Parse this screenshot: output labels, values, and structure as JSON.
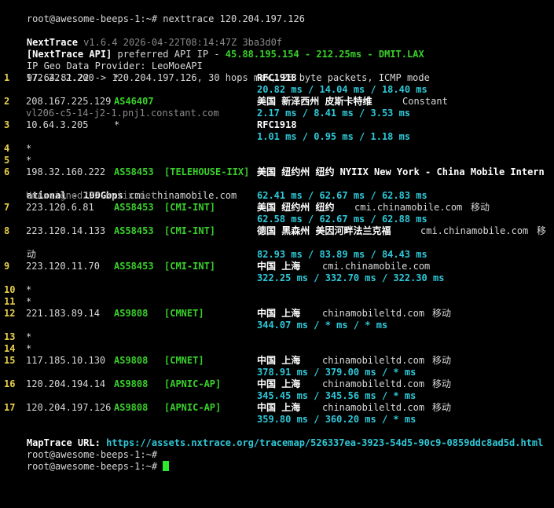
{
  "prompt": "root@awesome-beeps-1:~#",
  "command": " nexttrace 120.204.197.126",
  "header": {
    "app_name": "NextTrace",
    "version": " v1.6.4 2026-04-22T08:14:47Z 3ba3d0f",
    "api_label": "[NextTrace API]",
    "api_text": " preferred API IP - ",
    "api_ip": "45.88.195.154",
    "api_sep1": " - ",
    "api_latency": "212.25ms",
    "api_sep2": " - ",
    "api_node": "DMIT.LAX",
    "geo_provider": "IP Geo Data Provider: LeoMoeAPI",
    "route_summary": "97.64.81.22 -> 120.204.197.126, 30 hops max, 28 byte packets, ICMP mode"
  },
  "hops": [
    {
      "num": "1",
      "ip": "172.22.2.200",
      "asn": "*",
      "tag": "",
      "geo": "RFC1918",
      "domain": "",
      "note": "",
      "hostname": "",
      "rtt": "20.82 ms / 14.04 ms / 18.40 ms"
    },
    {
      "num": "2",
      "ip": "208.167.225.129",
      "asn": "AS46407",
      "tag": "",
      "geo": "美国 新泽西州 皮斯卡特维",
      "domain": "Constant",
      "note": "",
      "hostname": "vl206-c5-14-j2-1.pnj1.constant.com",
      "rtt": "2.17 ms / 8.41 ms / 3.53 ms"
    },
    {
      "num": "3",
      "ip": "10.64.3.205",
      "asn": "*",
      "tag": "",
      "geo": "RFC1918",
      "domain": "",
      "note": "",
      "hostname": "",
      "rtt": "1.01 ms / 0.95 ms / 1.18 ms"
    },
    {
      "num": "4",
      "ip": "*"
    },
    {
      "num": "5",
      "ip": "*"
    },
    {
      "num": "6",
      "ip": "198.32.160.222",
      "asn": "AS58453",
      "tag": "[TELEHOUSE-IIX]",
      "geo": "美国 纽约州 纽约 NYIIX New York - China Mobile Intern",
      "geo_wrap": "ational - 100Gbps",
      "domain": "cmi.chinamobile.com",
      "note": "",
      "hostname": "UnAssigned222.nyiix.net",
      "rtt": "62.41 ms / 62.67 ms / 62.83 ms"
    },
    {
      "num": "7",
      "ip": "223.120.6.81",
      "asn": "AS58453",
      "tag": "[CMI-INT]",
      "geo": "美国 纽约州 纽约",
      "domain": "cmi.chinamobile.com",
      "note": "移动",
      "hostname": "",
      "rtt": "62.58 ms / 62.67 ms / 62.88 ms"
    },
    {
      "num": "8",
      "ip": "223.120.14.133",
      "asn": "AS58453",
      "tag": "[CMI-INT]",
      "geo": "德国 黑森州 美因河畔法兰克福",
      "domain": "cmi.chinamobile.com",
      "note": "移",
      "note_wrap": "动",
      "hostname": "",
      "rtt": "82.93 ms / 83.89 ms / 84.43 ms"
    },
    {
      "num": "9",
      "ip": "223.120.11.70",
      "asn": "AS58453",
      "tag": "[CMI-INT]",
      "geo": "中国 上海",
      "domain": "cmi.chinamobile.com",
      "note": "",
      "hostname": "",
      "rtt": "322.25 ms / 332.70 ms / 322.30 ms"
    },
    {
      "num": "10",
      "ip": "*"
    },
    {
      "num": "11",
      "ip": "*"
    },
    {
      "num": "12",
      "ip": "221.183.89.14",
      "asn": "AS9808",
      "tag": "[CMNET]",
      "geo": "中国 上海",
      "domain": "chinamobileltd.com",
      "note": "移动",
      "hostname": "",
      "rtt": "344.07 ms / * ms / * ms"
    },
    {
      "num": "13",
      "ip": "*"
    },
    {
      "num": "14",
      "ip": "*"
    },
    {
      "num": "15",
      "ip": "117.185.10.130",
      "asn": "AS9808",
      "tag": "[CMNET]",
      "geo": "中国 上海",
      "domain": "chinamobileltd.com",
      "note": "移动",
      "hostname": "",
      "rtt": "378.91 ms / 379.00 ms / * ms"
    },
    {
      "num": "16",
      "ip": "120.204.194.14",
      "asn": "AS9808",
      "tag": "[APNIC-AP]",
      "geo": "中国 上海",
      "domain": "chinamobileltd.com",
      "note": "移动",
      "hostname": "",
      "rtt": "345.45 ms / 345.56 ms / * ms"
    },
    {
      "num": "17",
      "ip": "120.204.197.126",
      "asn": "AS9808",
      "tag": "[APNIC-AP]",
      "geo": "中国 上海",
      "domain": "chinamobileltd.com",
      "note": "移动",
      "hostname": "",
      "rtt": "359.80 ms / 360.20 ms / * ms"
    }
  ],
  "maptrace": {
    "label": "MapTrace URL: ",
    "url": "https://assets.nxtrace.org/tracemap/526337ea-3923-54d5-90c9-0859ddc8ad5d.html"
  },
  "colors": {
    "background": "#000000",
    "text": "#d8d8d8",
    "hop_number": "#e8d04a",
    "asn_and_tag": "#39d02a",
    "latency": "#2ec8d8",
    "hostname": "#8a8a8a",
    "cursor": "#2ee82e"
  }
}
